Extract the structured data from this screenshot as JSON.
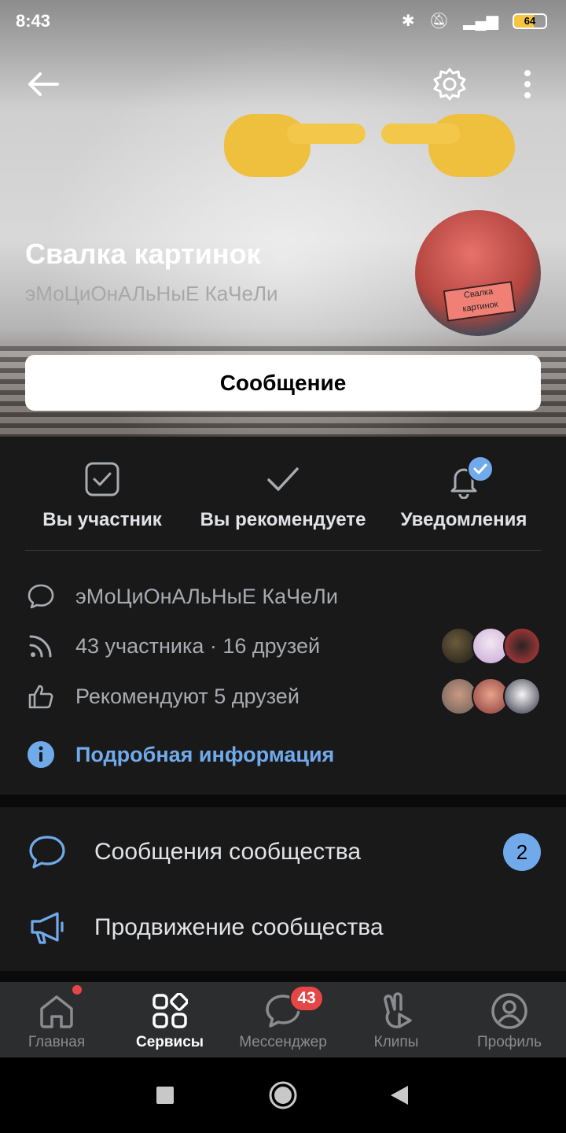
{
  "status_bar": {
    "time": "8:43",
    "battery": "64"
  },
  "group": {
    "title": "Свалка картинок",
    "status": "эМоЦиОнАЛьНыЕ КаЧеЛи",
    "avatar_sign": "Свалка картинок",
    "message_button": "Сообщение"
  },
  "actions": [
    {
      "label": "Вы участник"
    },
    {
      "label": "Вы рекомендуете"
    },
    {
      "label": "Уведомления"
    }
  ],
  "info": {
    "status_text": "эМоЦиОнАЛьНыЕ КаЧеЛи",
    "members_text": "43 участника · 16 друзей",
    "recommend_text": "Рекомендуют 5 друзей",
    "details_link": "Подробная информация"
  },
  "menu": {
    "messages_label": "Сообщения сообщества",
    "messages_count": "2",
    "promote_label": "Продвижение сообщества"
  },
  "tabs": [
    {
      "label": "Главная"
    },
    {
      "label": "Сервисы"
    },
    {
      "label": "Мессенджер",
      "badge": "43"
    },
    {
      "label": "Клипы"
    },
    {
      "label": "Профиль"
    }
  ],
  "colors": {
    "accent": "#71aaeb",
    "background": "#19191a",
    "tabbar": "#2c2d2e",
    "badge_red": "#e64646"
  }
}
